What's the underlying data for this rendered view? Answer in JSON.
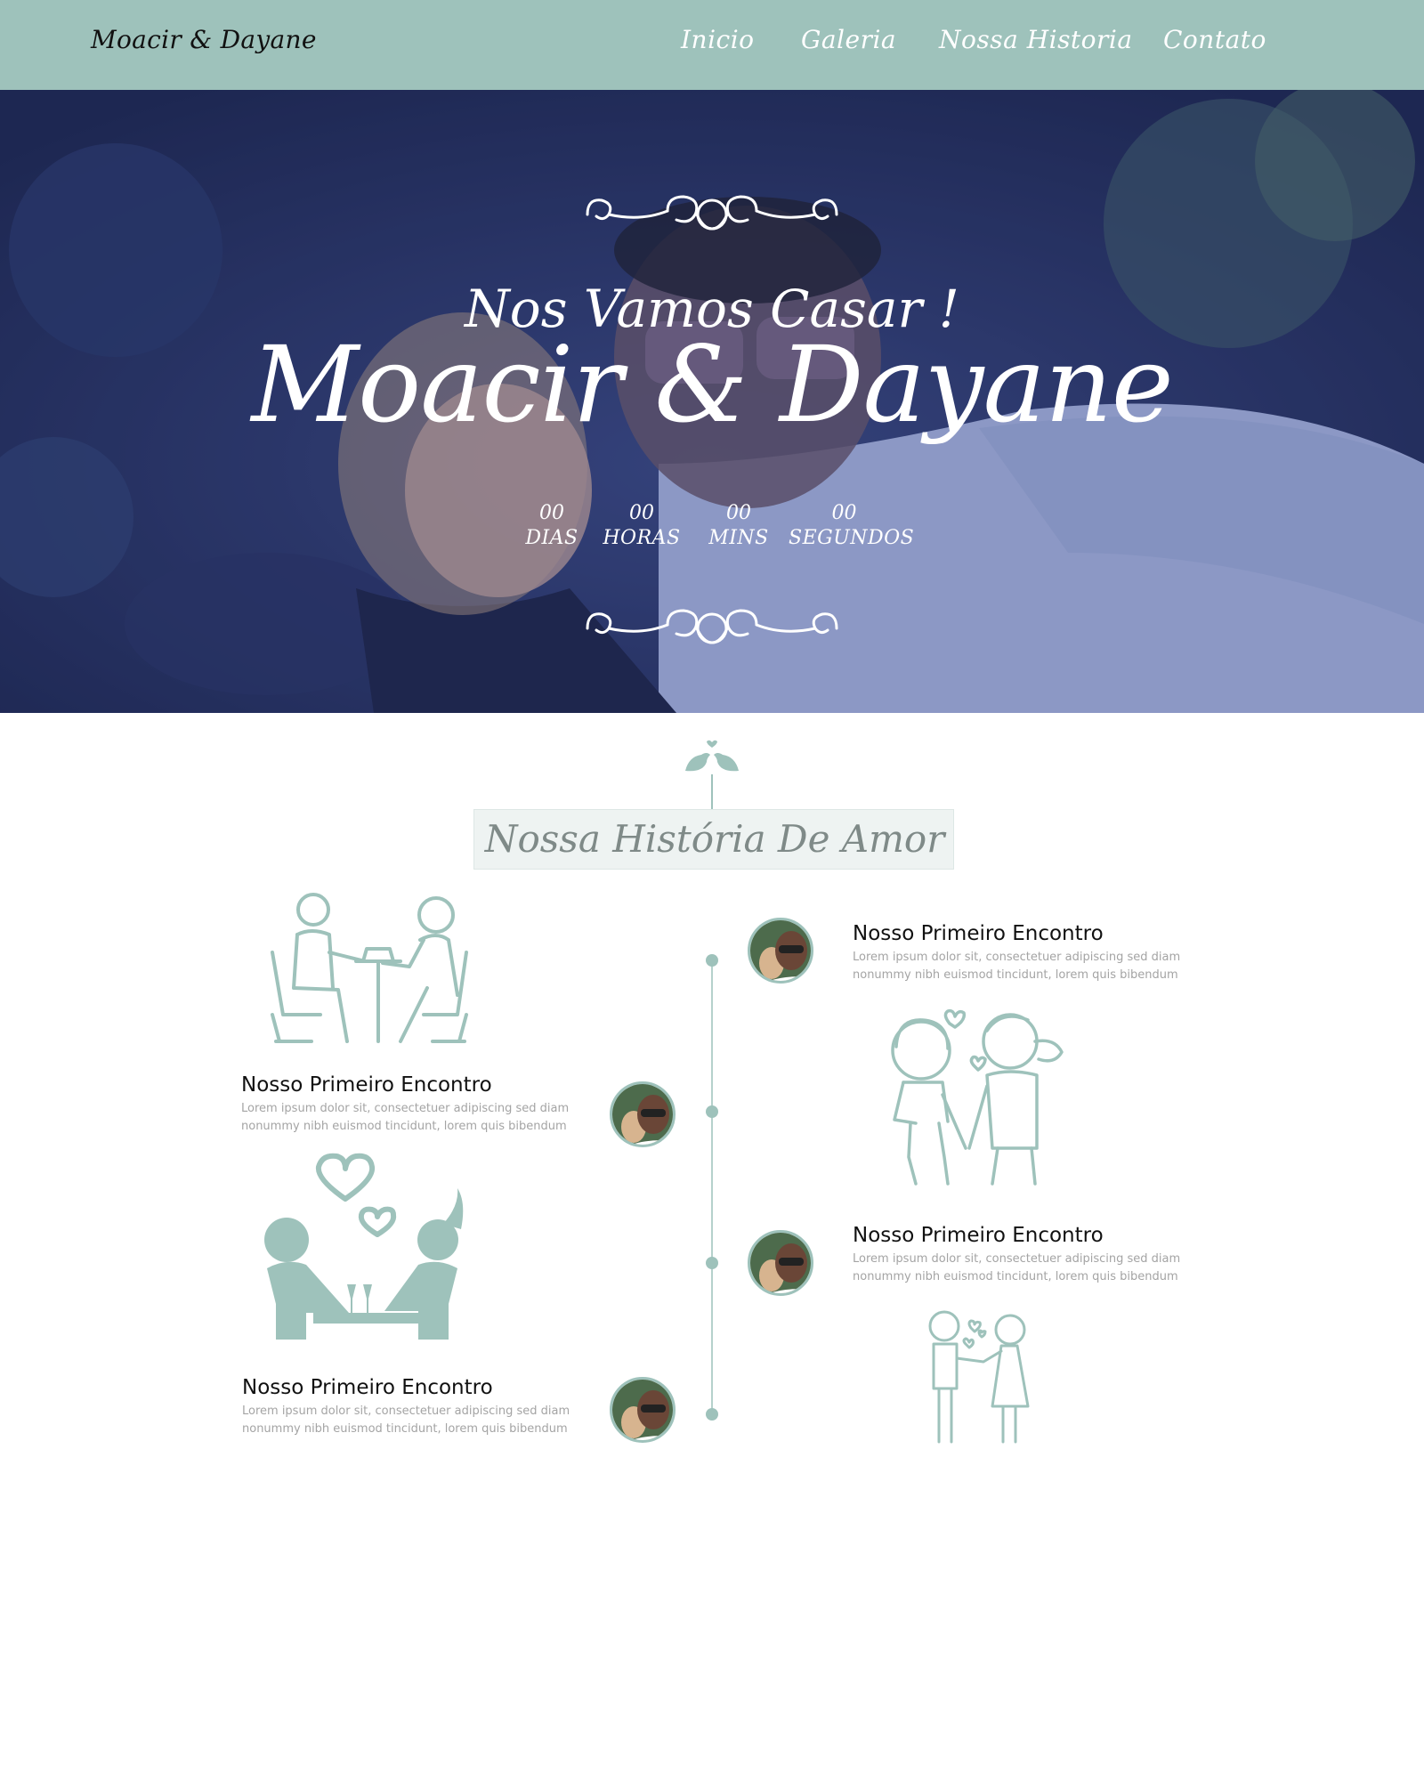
{
  "navbar": {
    "brand": "Moacir & Dayane",
    "links": [
      "Inicio",
      "Galeria",
      "Nossa Historia",
      "Contato"
    ]
  },
  "hero": {
    "subtitle": "Nos Vamos Casar !",
    "title": "Moacir & Dayane",
    "countdown": [
      {
        "value": "00",
        "label": "DIAS"
      },
      {
        "value": "00",
        "label": "HORAS"
      },
      {
        "value": "00",
        "label": "MINS"
      },
      {
        "value": "00",
        "label": "SEGUNDOS"
      }
    ]
  },
  "story": {
    "title": "Nossa História De Amor",
    "events": [
      {
        "title": "Nosso Primeiro Encontro",
        "text": "Lorem ipsum dolor sit, consectetuer adipiscing sed diam nonummy nibh euismod tincidunt, lorem quis bibendum"
      },
      {
        "title": "Nosso Primeiro Encontro",
        "text": "Lorem ipsum dolor sit, consectetuer adipiscing sed diam nonummy nibh euismod tincidunt, lorem quis bibendum"
      },
      {
        "title": "Nosso Primeiro Encontro",
        "text": "Lorem ipsum dolor sit, consectetuer adipiscing sed diam nonummy nibh euismod tincidunt, lorem quis bibendum"
      },
      {
        "title": "Nosso Primeiro Encontro",
        "text": "Lorem ipsum dolor sit, consectetuer adipiscing sed diam nonummy nibh euismod tincidunt, lorem quis bibendum"
      }
    ]
  },
  "colors": {
    "accent": "#9ec2bb",
    "hero_overlay": "#1e2a5c",
    "title_box": "#eef3f2",
    "muted_text": "#a4a4a4"
  },
  "icons": [
    "ornament-flourish-icon",
    "love-birds-icon",
    "couple-dinner-icon",
    "couple-holding-hands-icon",
    "couple-hearts-icon"
  ]
}
